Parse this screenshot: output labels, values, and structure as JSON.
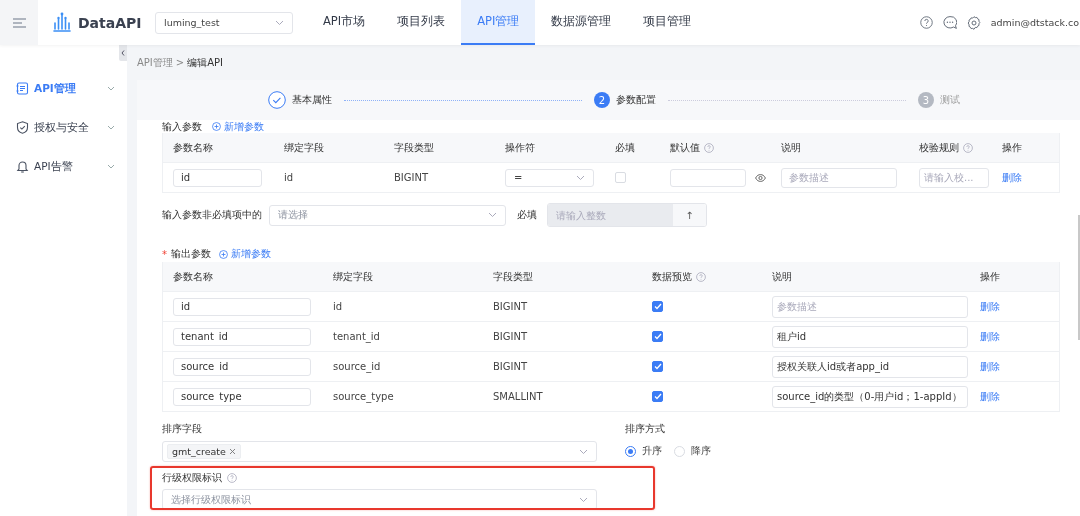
{
  "header": {
    "logo": "DataAPI",
    "project": "luming_test",
    "nav": [
      {
        "label": "API市场",
        "selected": false
      },
      {
        "label": "项目列表",
        "selected": false
      },
      {
        "label": "API管理",
        "selected": true
      },
      {
        "label": "数据源管理",
        "selected": false
      },
      {
        "label": "项目管理",
        "selected": false
      }
    ],
    "user": "admin@dtstack.co"
  },
  "sidebar": {
    "items": [
      {
        "label": "API管理",
        "kind": "list",
        "selected": true
      },
      {
        "label": "授权与安全",
        "kind": "shield",
        "selected": false
      },
      {
        "label": "API告警",
        "kind": "bell",
        "selected": false
      }
    ]
  },
  "breadcrumb": [
    "API管理",
    ">",
    "编辑API"
  ],
  "steps": [
    {
      "label": "基本属性",
      "done": true,
      "active": false
    },
    {
      "label": "参数配置",
      "done": false,
      "active": true,
      "number": "2"
    },
    {
      "label": "测试",
      "done": false,
      "active": false,
      "number": "3"
    }
  ],
  "input_params": {
    "title": "输入参数",
    "add": "新增参数",
    "columns": [
      {
        "label": "参数名称",
        "help": false
      },
      {
        "label": "绑定字段",
        "help": false
      },
      {
        "label": "字段类型",
        "help": false
      },
      {
        "label": "操作符",
        "help": false
      },
      {
        "label": "必填",
        "help": false
      },
      {
        "label": "默认值",
        "help": true
      },
      {
        "label": "说明",
        "help": false
      },
      {
        "label": "校验规则",
        "help": true
      },
      {
        "label": "操作",
        "help": false
      }
    ],
    "rows": [
      {
        "name": "id",
        "field": "id",
        "type": "BIGINT",
        "operator": "=",
        "required": false,
        "desc_placeholder": "参数描述",
        "rule_placeholder": "请输入校...",
        "action": "删除"
      }
    ]
  },
  "optional_rule": {
    "label": "输入参数非必填项中的",
    "placeholder": "请选择",
    "suffix": "必填",
    "number_placeholder": "请输入整数",
    "step": "↑"
  },
  "output_params": {
    "required_mark": "*",
    "title": "输出参数",
    "add": "新增参数",
    "columns": [
      {
        "label": "参数名称",
        "help": false
      },
      {
        "label": "绑定字段",
        "help": false
      },
      {
        "label": "字段类型",
        "help": false
      },
      {
        "label": "数据预览",
        "help": true
      },
      {
        "label": "说明",
        "help": false
      },
      {
        "label": "操作",
        "help": false
      }
    ],
    "rows": [
      {
        "name": "id",
        "field": "id",
        "type": "BIGINT",
        "preview": true,
        "desc": "",
        "desc_placeholder": "参数描述",
        "action": "删除"
      },
      {
        "name": "tenant_id",
        "field": "tenant_id",
        "type": "BIGINT",
        "preview": true,
        "desc": "租户id",
        "action": "删除"
      },
      {
        "name": "source_id",
        "field": "source_id",
        "type": "BIGINT",
        "preview": true,
        "desc": "授权关联人id或者app_id",
        "action": "删除"
      },
      {
        "name": "source_type",
        "field": "source_type",
        "type": "SMALLINT",
        "preview": true,
        "desc": "source_id的类型（0-用户id；1-appId）",
        "action": "删除"
      }
    ]
  },
  "sort": {
    "label": "排序字段",
    "tags": [
      "gmt_create"
    ],
    "order_label": "排序方式",
    "orders": [
      {
        "label": "升序",
        "selected": true
      },
      {
        "label": "降序",
        "selected": false
      }
    ]
  },
  "row_permission": {
    "label": "行级权限标识",
    "placeholder": "选择行级权限标识",
    "highlighted": true
  }
}
